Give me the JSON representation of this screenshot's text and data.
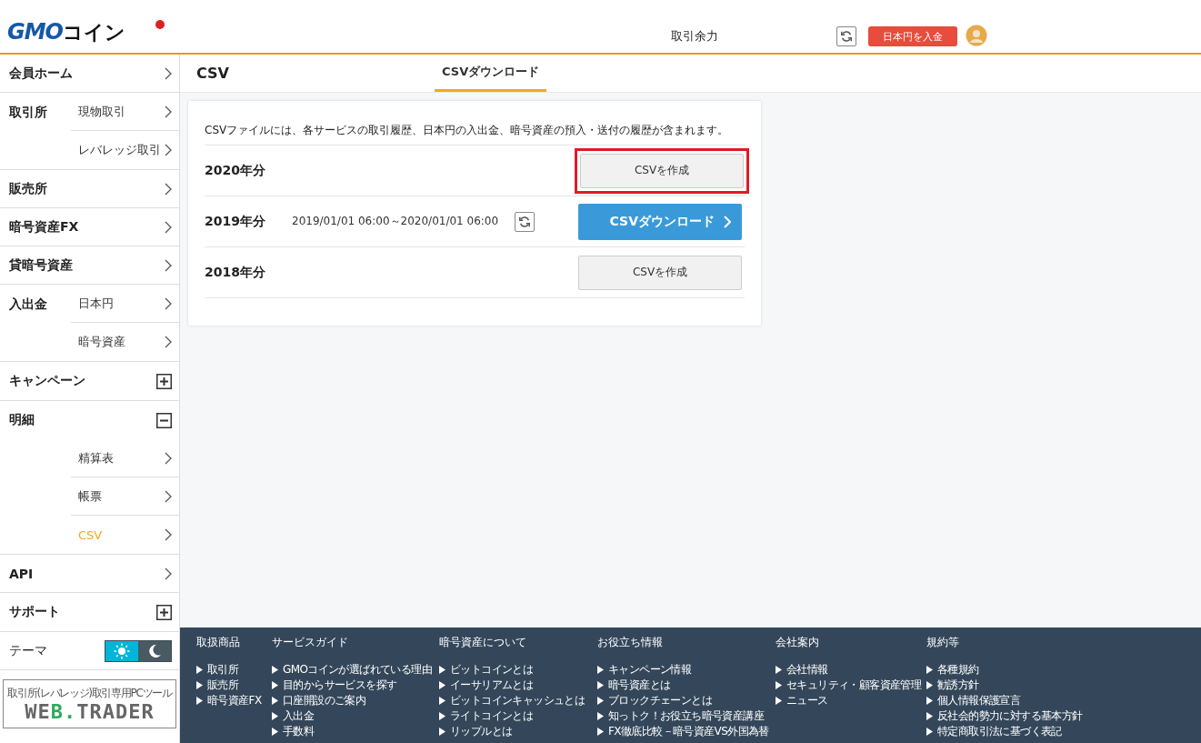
{
  "header": {
    "logo": {
      "brand": "GMO",
      "name": "コイン"
    },
    "balance_label": "取引余力",
    "deposit_button": "日本円を入金"
  },
  "sidebar": {
    "groups": [
      {
        "label": "会員ホーム",
        "kind": "link",
        "selected": false
      },
      {
        "label": "取引所",
        "kind": "inline",
        "children": [
          {
            "label": "現物取引",
            "selected": false
          },
          {
            "label": "レバレッジ取引",
            "selected": false
          }
        ]
      },
      {
        "label": "販売所",
        "kind": "link",
        "selected": false
      },
      {
        "label": "暗号資産FX",
        "kind": "link",
        "selected": false
      },
      {
        "label": "貸暗号資産",
        "kind": "link",
        "selected": false
      },
      {
        "label": "入出金",
        "kind": "inline",
        "children": [
          {
            "label": "日本円",
            "selected": false
          },
          {
            "label": "暗号資産",
            "selected": false
          }
        ]
      },
      {
        "label": "キャンペーン",
        "kind": "expandable",
        "expanded": false
      },
      {
        "label": "明細",
        "kind": "expandable",
        "expanded": true,
        "children": [
          {
            "label": "精算表",
            "selected": false
          },
          {
            "label": "帳票",
            "selected": false
          },
          {
            "label": "CSV",
            "selected": true
          }
        ]
      },
      {
        "label": "API",
        "kind": "link",
        "selected": false
      },
      {
        "label": "サポート",
        "kind": "expandable",
        "expanded": false
      }
    ],
    "theme": {
      "label": "テーマ",
      "options": [
        {
          "kind": "sun",
          "selected": true
        },
        {
          "kind": "moon",
          "selected": false
        }
      ]
    },
    "banner": {
      "caption": "取引所(レバレッジ)取引専用PCツール",
      "title_parts": [
        {
          "text": "WE",
          "accent": false
        },
        {
          "text": "B.",
          "accent": true
        },
        {
          "text": "TRADER",
          "accent": false
        }
      ]
    }
  },
  "page": {
    "title": "CSV",
    "tabs": [
      {
        "label": "CSVダウンロード",
        "selected": true
      }
    ]
  },
  "card": {
    "note": "CSVファイルには、各サービスの取引履歴、日本円の入出金、暗号資産の預入・送付の履歴が含まれます。",
    "rows": [
      {
        "year": "2020年分",
        "button": {
          "kind": "create",
          "label": "CSVを作成",
          "highlighted": true
        }
      },
      {
        "year": "2019年分",
        "period": "2019/01/01 06:00～2020/01/01 06:00",
        "refresh": true,
        "button": {
          "kind": "download",
          "label": "CSVダウンロード",
          "highlighted": false
        }
      },
      {
        "year": "2018年分",
        "button": {
          "kind": "create",
          "label": "CSVを作成",
          "highlighted": false
        }
      }
    ]
  },
  "footer": {
    "columns": [
      {
        "heading": "取扱商品",
        "links": [
          "取引所",
          "販売所",
          "暗号資産FX"
        ]
      },
      {
        "heading": "サービスガイド",
        "links": [
          "GMOコインが選ばれている理由",
          "目的からサービスを探す",
          "口座開設のご案内",
          "入出金",
          "手数料"
        ]
      },
      {
        "heading": "暗号資産について",
        "links": [
          "ビットコインとは",
          "イーサリアムとは",
          "ビットコインキャッシュとは",
          "ライトコインとは",
          "リップルとは"
        ]
      },
      {
        "heading": "お役立ち情報",
        "links": [
          "キャンペーン情報",
          "暗号資産とは",
          "ブロックチェーンとは",
          "知っトク！お役立ち暗号資産講座",
          "FX徹底比較－暗号資産VS外国為替"
        ]
      },
      {
        "heading": "会社案内",
        "links": [
          "会社情報",
          "セキュリティ・顧客資産管理",
          "ニュース"
        ]
      },
      {
        "heading": "規約等",
        "links": [
          "各種規約",
          "勧誘方針",
          "個人情報保護宣言",
          "反社会的勢力に対する基本方針",
          "特定商取引法に基づく表記"
        ]
      }
    ]
  }
}
